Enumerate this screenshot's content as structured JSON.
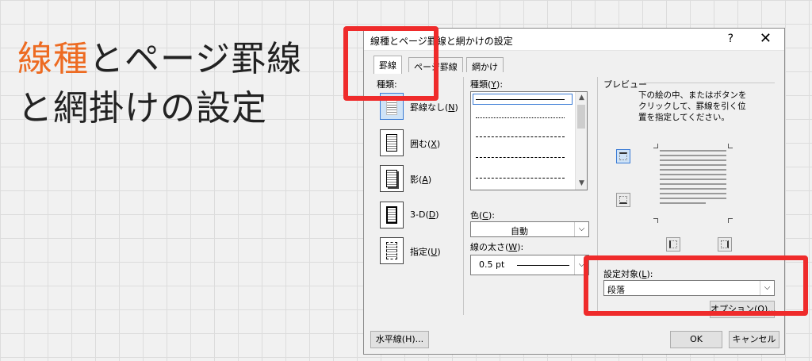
{
  "slide": {
    "title_line1_accent": "線種",
    "title_line1_rest": "とページ罫線",
    "title_line2": "と網掛けの設定"
  },
  "dialog": {
    "title": "線種とページ罫線と網かけの設定",
    "help": "?",
    "close": "✕",
    "tabs": [
      "罫線",
      "ページ罫線",
      "網かけ"
    ],
    "settings": {
      "label": "種類:",
      "items": [
        {
          "label": "罫線なし",
          "key": "N"
        },
        {
          "label": "囲む",
          "key": "X"
        },
        {
          "label": "影",
          "key": "A"
        },
        {
          "label": "3-D",
          "key": "D"
        },
        {
          "label": "指定",
          "key": "U"
        }
      ]
    },
    "style": {
      "label": "種類",
      "key": "Y"
    },
    "color": {
      "label": "色",
      "key": "C",
      "value": "自動"
    },
    "width": {
      "label": "線の太さ",
      "key": "W",
      "value": "0.5 pt"
    },
    "preview": {
      "label": "プレビュー",
      "instructions": "下の絵の中、またはボタンを\nクリックして、罫線を引く位\n置を指定してください。"
    },
    "apply_to": {
      "label": "設定対象",
      "key": "L",
      "value": "段落"
    },
    "options_button": "オプション(O)...",
    "horizontal_line_button": "水平線(H)...",
    "ok_button": "OK",
    "cancel_button": "キャンセル"
  },
  "colors": {
    "accent": "#ed6b22",
    "highlight": "#ef2b2b"
  }
}
